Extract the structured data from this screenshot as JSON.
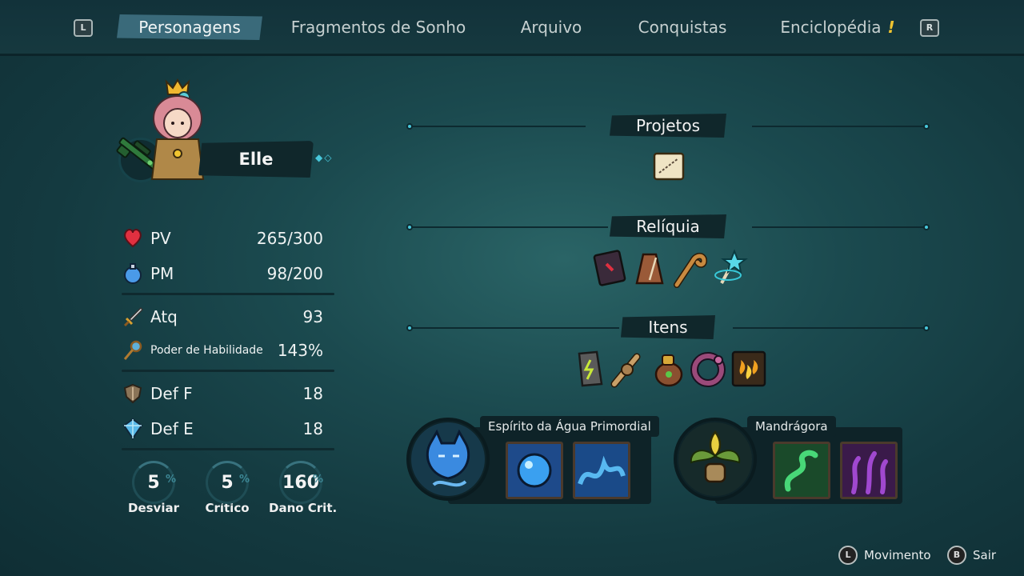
{
  "nav": {
    "left_button": "L",
    "right_button": "R",
    "tabs": [
      {
        "label": "Personagens",
        "active": true
      },
      {
        "label": "Fragmentos de Sonho",
        "active": false
      },
      {
        "label": "Arquivo",
        "active": false
      },
      {
        "label": "Conquistas",
        "active": false
      },
      {
        "label": "Enciclopédia",
        "active": false,
        "alert": "!"
      }
    ]
  },
  "character": {
    "name": "Elle",
    "weapon_icon": "sniper-rifle-icon"
  },
  "stats": [
    {
      "icon": "heart-icon",
      "label": "PV",
      "value": "265/300"
    },
    {
      "icon": "mana-potion-icon",
      "label": "PM",
      "value": "98/200"
    },
    {
      "icon": "sword-icon",
      "label": "Atq",
      "value": "93"
    },
    {
      "icon": "magic-wand-icon",
      "label": "Poder de Habilidade",
      "value": "143%"
    },
    {
      "icon": "shield-icon",
      "label": "Def F",
      "value": "18"
    },
    {
      "icon": "gem-shield-icon",
      "label": "Def E",
      "value": "18"
    }
  ],
  "ring_stats": [
    {
      "value": "5",
      "unit": "%",
      "label": "Desviar"
    },
    {
      "value": "5",
      "unit": "%",
      "label": "Crítico"
    },
    {
      "value": "160",
      "unit": "%",
      "label": "Dano Crit."
    }
  ],
  "sections": {
    "projects": {
      "title": "Projetos",
      "items": [
        "blueprint-scroll-icon"
      ]
    },
    "relics": {
      "title": "Relíquia",
      "items": [
        "red-book-icon",
        "metronome-icon",
        "shepherd-crook-icon",
        "star-wand-icon"
      ]
    },
    "items": {
      "title": "Itens",
      "items": [
        "lightning-rune-icon",
        "rope-knot-icon",
        "pouch-icon",
        "ouroboros-ring-icon",
        "fire-scroll-icon"
      ]
    }
  },
  "companions": [
    {
      "name": "Espírito da Água Primordial",
      "portrait": "water-spirit-cat-icon",
      "skills": [
        "water-bubble-icon",
        "water-wave-icon"
      ]
    },
    {
      "name": "Mandrágora",
      "portrait": "mandrake-icon",
      "skills": [
        "green-vine-icon",
        "purple-tentacle-icon"
      ]
    }
  ],
  "hints": [
    {
      "button": "L",
      "label": "Movimento"
    },
    {
      "button": "B",
      "label": "Sair"
    }
  ],
  "colors": {
    "accent": "#48c8dc",
    "active_tab": "#3a6a7a",
    "alert": "#f0c430"
  }
}
